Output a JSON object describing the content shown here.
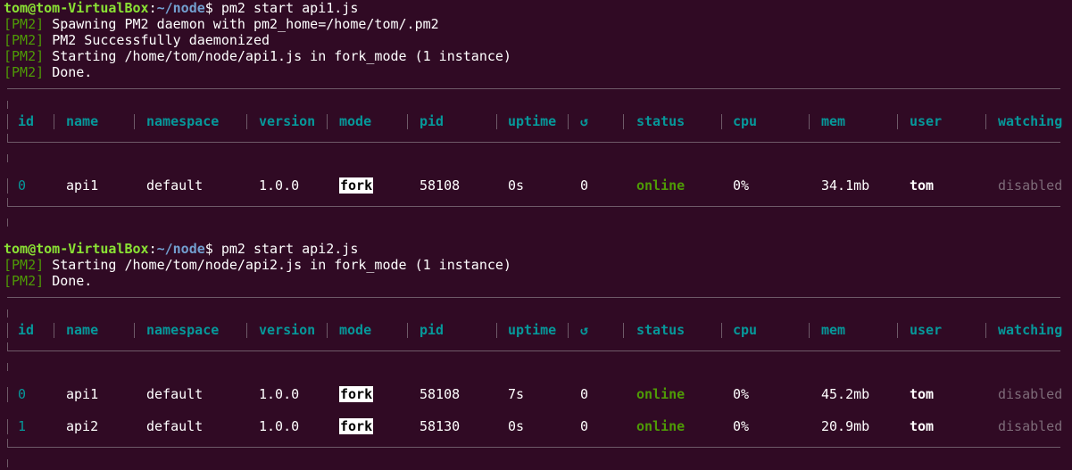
{
  "block1": {
    "prompt_user": "tom@tom-VirtualBox",
    "prompt_colon": ":",
    "prompt_path": "~/node",
    "prompt_symbol": "$ ",
    "command": "pm2 start api1.js",
    "log_tag": "[PM2]",
    "logs": [
      "Spawning PM2 daemon with pm2_home=/home/tom/.pm2",
      "PM2 Successfully daemonized",
      "Starting /home/tom/node/api1.js in fork_mode (1 instance)",
      "Done."
    ]
  },
  "block2": {
    "prompt_user": "tom@tom-VirtualBox",
    "prompt_colon": ":",
    "prompt_path": "~/node",
    "prompt_symbol": "$ ",
    "command": "pm2 start api2.js",
    "log_tag": "[PM2]",
    "logs": [
      "Starting /home/tom/node/api2.js in fork_mode (1 instance)",
      "Done."
    ]
  },
  "table_headers": [
    "id",
    "name",
    "namespace",
    "version",
    "mode",
    "pid",
    "uptime",
    "↺",
    "status",
    "cpu",
    "mem",
    "user",
    "watching"
  ],
  "table1_rows": [
    [
      "0",
      "api1",
      "default",
      "1.0.0",
      "fork",
      "58108",
      "0s",
      "0",
      "online",
      "0%",
      "34.1mb",
      "tom",
      "disabled"
    ]
  ],
  "table2_rows": [
    [
      "0",
      "api1",
      "default",
      "1.0.0",
      "fork",
      "58108",
      "7s",
      "0",
      "online",
      "0%",
      "45.2mb",
      "tom",
      "disabled"
    ],
    [
      "1",
      "api2",
      "default",
      "1.0.0",
      "fork",
      "58130",
      "0s",
      "0",
      "online",
      "0%",
      "20.9mb",
      "tom",
      "disabled"
    ]
  ],
  "colors": {
    "background": "#300a24",
    "prompt_user": "#8ae234",
    "prompt_path": "#729fcf",
    "pm2_tag": "#4e9a06",
    "header_cyan": "#06989a",
    "status_online": "#4e9a06",
    "disabled_gray": "#7d6b78"
  }
}
